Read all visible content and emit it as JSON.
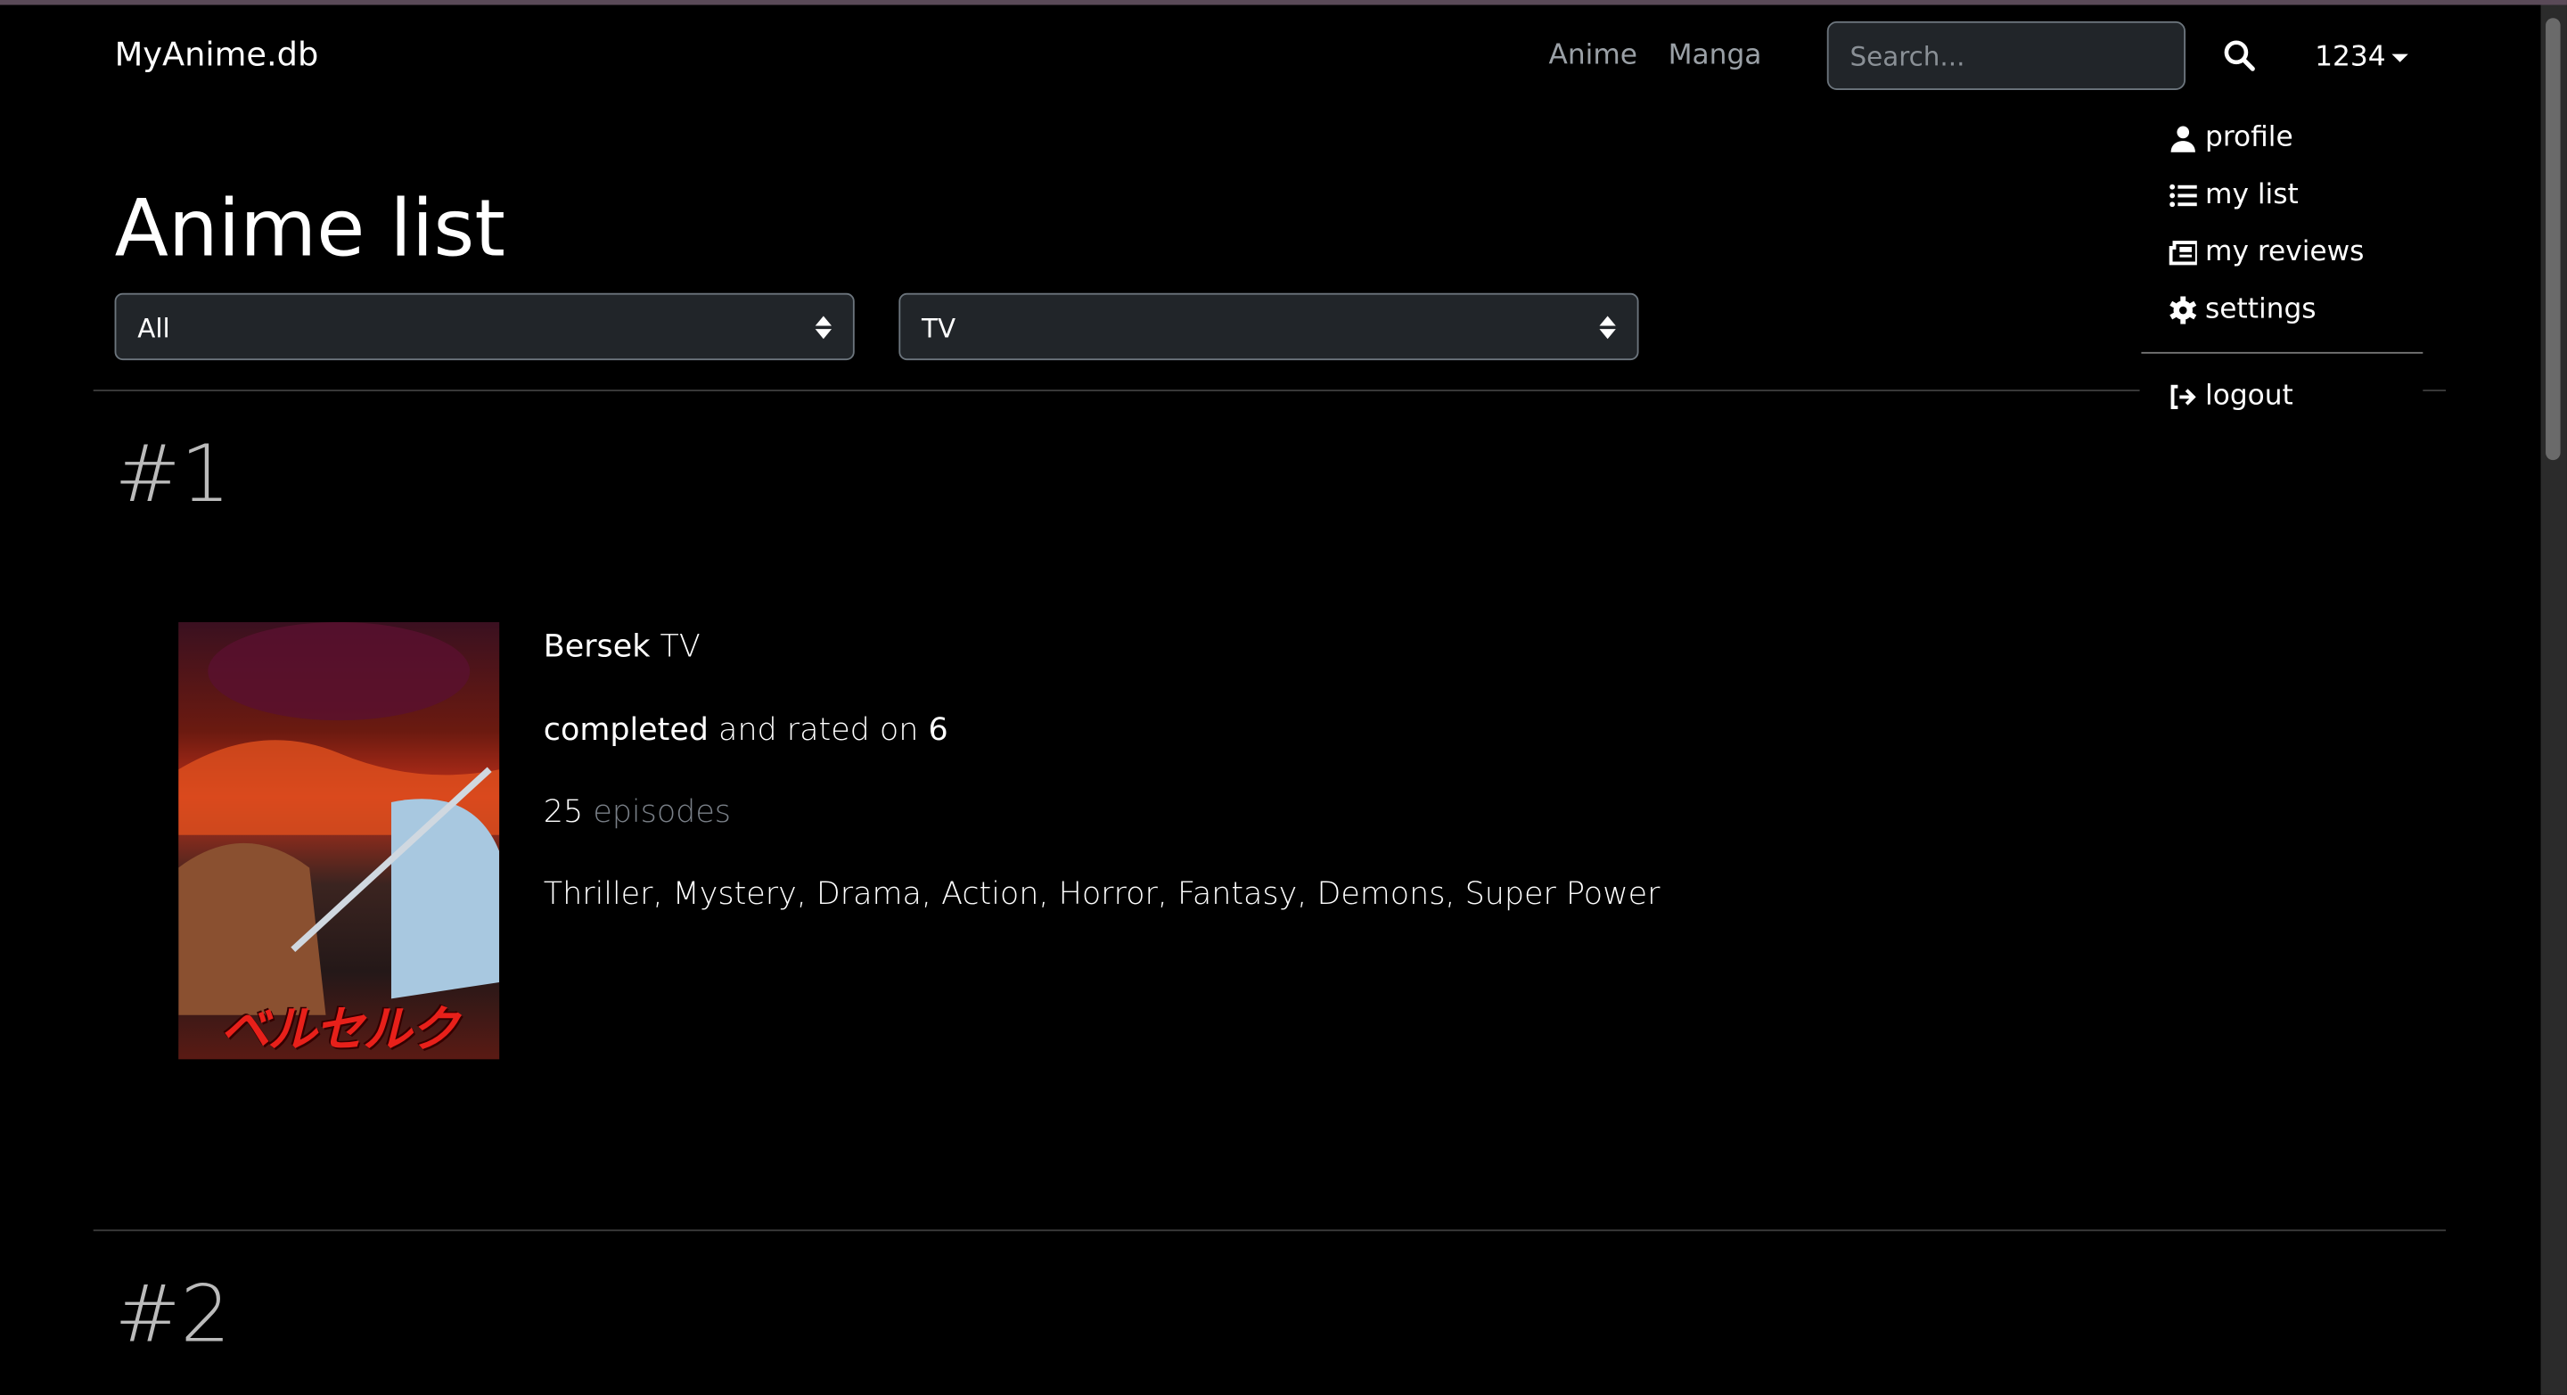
{
  "navbar": {
    "brand": "MyAnime.db",
    "links": [
      "Anime",
      "Manga"
    ],
    "search_placeholder": "Search...",
    "user": "1234"
  },
  "user_menu": {
    "items": [
      {
        "label": "profile",
        "icon": "user-icon"
      },
      {
        "label": "my list",
        "icon": "list-icon"
      },
      {
        "label": "my reviews",
        "icon": "newspaper-icon"
      },
      {
        "label": "settings",
        "icon": "gear-icon"
      }
    ],
    "logout": {
      "label": "logout",
      "icon": "sign-out-icon"
    }
  },
  "page": {
    "title": "Anime list",
    "filters": [
      {
        "value": "All"
      },
      {
        "value": "TV"
      }
    ]
  },
  "entries": [
    {
      "rank": "#1",
      "title": "Bersek",
      "type": "TV",
      "status": "completed",
      "rated_text": "and rated on",
      "rating": "6",
      "episodes": "25",
      "episodes_label": "episodes",
      "genres": "Thriller, Mystery, Drama, Action, Horror, Fantasy, Demons, Super Power",
      "poster_text": "ベルセルク"
    },
    {
      "rank": "#2"
    }
  ]
}
